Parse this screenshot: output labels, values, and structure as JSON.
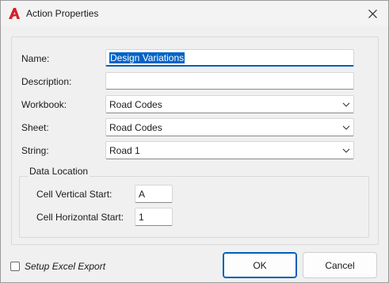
{
  "window": {
    "title": "Action Properties",
    "app_icon": "autodesk-a-logo",
    "close_icon": "close-icon"
  },
  "form": {
    "name_label": "Name:",
    "name_value": "Design Variations",
    "description_label": "Description:",
    "description_value": "",
    "workbook_label": "Workbook:",
    "workbook_value": "Road Codes",
    "sheet_label": "Sheet:",
    "sheet_value": "Road Codes",
    "string_label": "String:",
    "string_value": "Road 1"
  },
  "data_location": {
    "title": "Data Location",
    "vertical_label": "Cell Vertical Start:",
    "vertical_value": "A",
    "horizontal_label": "Cell Horizontal Start:",
    "horizontal_value": "1"
  },
  "footer": {
    "setup_export_label": "Setup Excel Export",
    "setup_export_checked": false,
    "ok_label": "OK",
    "cancel_label": "Cancel"
  },
  "colors": {
    "accent": "#005fb8",
    "selection": "#0063c7",
    "brand_red": "#d5202c"
  }
}
